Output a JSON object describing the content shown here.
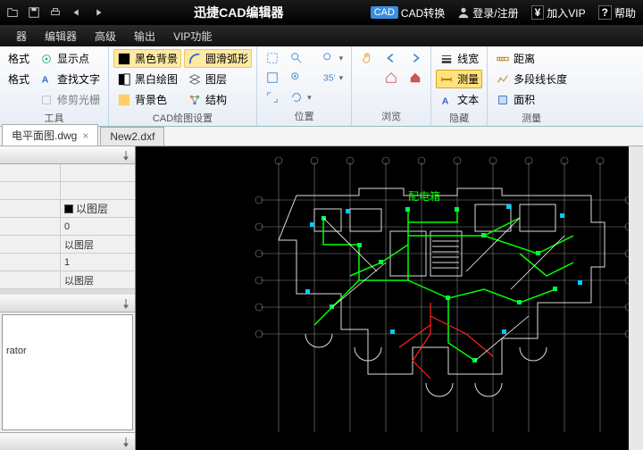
{
  "titlebar": {
    "app_title": "迅捷CAD编辑器",
    "cad_convert": "CAD转换",
    "login": "登录/注册",
    "vip": "加入VIP",
    "help": "帮助"
  },
  "menubar": {
    "items": [
      "器",
      "编辑器",
      "高级",
      "输出",
      "VIP功能"
    ]
  },
  "ribbon": {
    "groups": [
      {
        "label": "工具",
        "items": [
          {
            "label": "显示点",
            "icon": "point"
          },
          {
            "label": "查找文字",
            "icon": "find"
          },
          {
            "label": "修剪光栅",
            "icon": "crop"
          }
        ],
        "prefix": [
          "格式",
          "格式"
        ]
      },
      {
        "label": "CAD绘图设置",
        "items": [
          {
            "label": "黑色背景",
            "active": true,
            "icon": "blackbg"
          },
          {
            "label": "黑白绘图",
            "icon": "bw"
          },
          {
            "label": "背景色",
            "icon": "bgcolor"
          },
          {
            "label": "圆滑弧形",
            "active": true,
            "icon": "arc"
          },
          {
            "label": "图层",
            "icon": "layer"
          },
          {
            "label": "结构",
            "icon": "struct"
          }
        ]
      },
      {
        "label": "位置",
        "items": [
          {
            "icon": "i1"
          },
          {
            "icon": "i2"
          },
          {
            "icon": "i3"
          },
          {
            "icon": "i4"
          },
          {
            "icon": "i5"
          },
          {
            "icon": "i6"
          },
          {
            "icon": "i7"
          },
          {
            "icon": "i8"
          }
        ]
      },
      {
        "label": "浏览",
        "items": [
          {
            "icon": "hand"
          },
          {
            "icon": "back"
          },
          {
            "icon": "fwd"
          },
          {
            "icon": "home"
          },
          {
            "icon": "home2"
          }
        ]
      },
      {
        "label": "隐藏",
        "items": [
          {
            "label": "线宽",
            "icon": "lw"
          },
          {
            "label": "测量",
            "yellow": true,
            "icon": "measure"
          },
          {
            "label": "文本",
            "icon": "text"
          }
        ]
      },
      {
        "label": "测量",
        "items": [
          {
            "label": "距离",
            "icon": "dist"
          },
          {
            "label": "多段线长度",
            "icon": "poly"
          },
          {
            "label": "面积",
            "icon": "area"
          }
        ]
      }
    ]
  },
  "tabs": [
    {
      "label": "电平面图.dwg",
      "active": true
    },
    {
      "label": "New2.dxf"
    }
  ],
  "side_panel": {
    "rows": [
      {
        "a": "",
        "b": "以图层",
        "swatch": true
      },
      {
        "a": "",
        "b": "0"
      },
      {
        "a": "",
        "b": "以图层"
      },
      {
        "a": "",
        "b": "1"
      },
      {
        "a": "",
        "b": "以图层"
      }
    ],
    "bottom_text": "rator"
  }
}
